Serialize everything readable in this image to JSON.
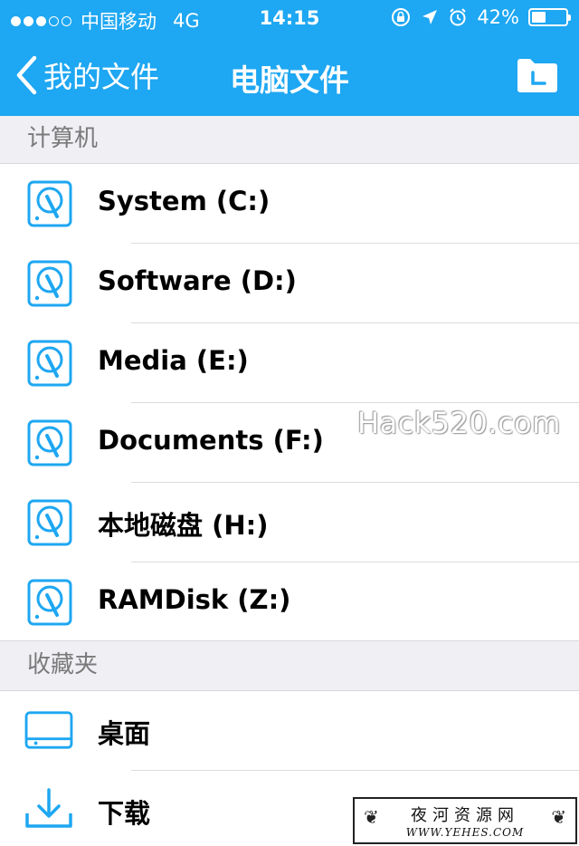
{
  "status_bar": {
    "carrier": "中国移动",
    "network": "4G",
    "time": "14:15",
    "battery_percent": "42%",
    "battery_level": 0.42,
    "signal_dots_filled": 3,
    "signal_dots_total": 5
  },
  "nav": {
    "back_label": "我的文件",
    "title": "电脑文件"
  },
  "sections": {
    "computer": {
      "title": "计算机",
      "drives": [
        {
          "label": "System (C:)"
        },
        {
          "label": "Software (D:)"
        },
        {
          "label": "Media (E:)"
        },
        {
          "label": "Documents (F:)"
        },
        {
          "label": "本地磁盘 (H:)"
        },
        {
          "label": "RAMDisk (Z:)"
        }
      ]
    },
    "favorites": {
      "title": "收藏夹",
      "items": [
        {
          "label": "桌面",
          "icon": "desktop-icon"
        },
        {
          "label": "下载",
          "icon": "download-icon"
        }
      ]
    }
  },
  "watermark": "Hack520.com",
  "stamp": {
    "cn": "夜河资源网",
    "en": "WWW.YEHES.COM"
  },
  "colors": {
    "accent": "#1ea7f2",
    "section_bg": "#efeff4"
  }
}
